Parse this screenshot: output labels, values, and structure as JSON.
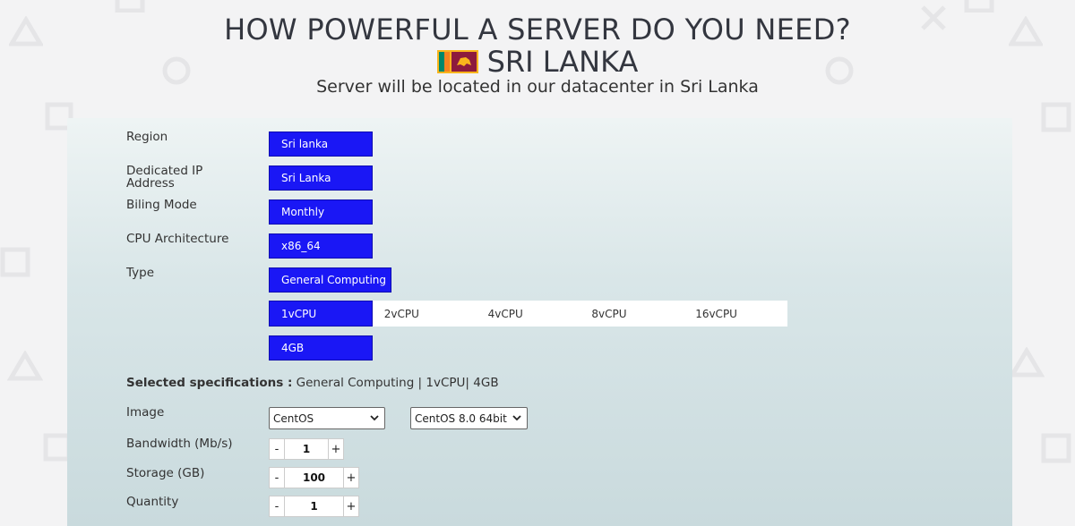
{
  "header": {
    "title": "HOW POWERFUL A SERVER DO YOU NEED?",
    "country": "SRI LANKA",
    "tagline": "Server will be located in our datacenter in Sri Lanka"
  },
  "form": {
    "region": {
      "label": "Region",
      "value": "Sri lanka"
    },
    "dedicated_ip": {
      "label": "Dedicated IP Address",
      "value": "Sri Lanka"
    },
    "billing": {
      "label": "Biling Mode",
      "value": "Monthly"
    },
    "cpu_arch": {
      "label": "CPU Architecture",
      "value": "x86_64"
    },
    "type": {
      "label": "Type",
      "value": "General Computing"
    },
    "vcpu_options": [
      "1vCPU",
      "2vCPU",
      "4vCPU",
      "8vCPU",
      "16vCPU"
    ],
    "vcpu_selected": "1vCPU",
    "memory": {
      "value": "4GB"
    },
    "selected_specs": {
      "label": "Selected specifications :",
      "value": "General Computing | 1vCPU| 4GB"
    },
    "image": {
      "label": "Image",
      "os": "CentOS",
      "version": "CentOS 8.0 64bit"
    },
    "bandwidth": {
      "label": "Bandwidth (Mb/s)",
      "value": "1"
    },
    "storage": {
      "label": "Storage (GB)",
      "value": "100"
    },
    "quantity": {
      "label": "Quantity",
      "value": "1"
    },
    "minus": "-",
    "plus": "+"
  },
  "colors": {
    "accent": "#1a17f5",
    "background": "#f3f3f4"
  }
}
